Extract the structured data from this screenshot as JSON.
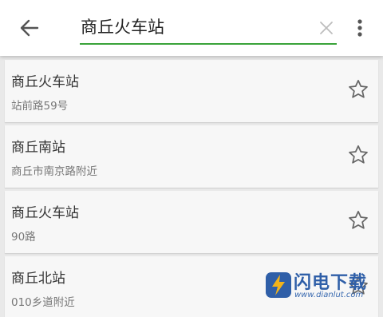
{
  "search": {
    "value": "商丘火车站",
    "placeholder": ""
  },
  "icons": {
    "back": "arrow-back-icon",
    "clear": "close-icon",
    "more": "more-vertical-icon",
    "favorite": "star-outline-icon"
  },
  "colors": {
    "accent": "#3aa33a",
    "background": "#e9e9e9",
    "card": "#f7f7f7"
  },
  "results": [
    {
      "name": "商丘火车站",
      "address": "站前路59号"
    },
    {
      "name": "商丘南站",
      "address": "商丘市南京路附近"
    },
    {
      "name": "商丘火车站",
      "address": "90路"
    },
    {
      "name": "商丘北站",
      "address": "010乡道附近"
    }
  ],
  "watermark": {
    "title": "闪电下载",
    "url": "www.dianlut.com"
  }
}
